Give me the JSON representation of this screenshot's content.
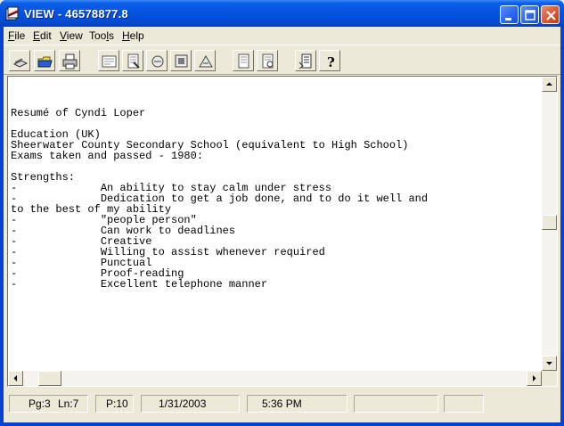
{
  "window": {
    "title": "VIEW - 46578877.8",
    "icons": [
      "app-icon"
    ],
    "controls": [
      "minimize-icon",
      "maximize-icon",
      "close-icon"
    ]
  },
  "menubar": {
    "items": [
      {
        "label": "File",
        "accel": "F",
        "rest": "ile"
      },
      {
        "label": "Edit",
        "accel": "E",
        "rest": "dit"
      },
      {
        "label": "View",
        "accel": "V",
        "rest": "iew"
      },
      {
        "label": "Tools",
        "pre": "Too",
        "accel": "l",
        "rest": "s"
      },
      {
        "label": "Help",
        "accel": "H",
        "rest": "elp"
      }
    ]
  },
  "toolbar": {
    "buttons": [
      "open-icon",
      "folder-icon",
      "print-icon",
      "view-a-icon",
      "view-b-icon",
      "view-c-icon",
      "view-d-icon",
      "view-e-icon",
      "page-prev-icon",
      "page-next-icon",
      "doc-info-icon",
      "help-icon"
    ]
  },
  "document": {
    "lines": [
      "Resumé of Cyndi Loper",
      "",
      "Education (UK)",
      "Sheerwater County Secondary School (equivalent to High School)",
      "Exams taken and passed - 1980:",
      "",
      "Strengths:",
      "-             An ability to stay calm under stress",
      "-             Dedication to get a job done, and to do it well and",
      "to the best of my ability",
      "-             \"people person\"",
      "-             Can work to deadlines",
      "-             Creative",
      "-             Willing to assist whenever required",
      "-             Punctual",
      "-             Proof-reading",
      "-             Excellent telephone manner"
    ]
  },
  "statusbar": {
    "page": "Pg:3",
    "line": "Ln:7",
    "paragraph": "P:10",
    "date": "1/31/2003",
    "time": "5:36 PM",
    "extra1": "",
    "extra2": ""
  },
  "colors": {
    "titlebar": "#0453e0",
    "chrome": "#ece9d8",
    "document_bg": "#ffffff",
    "close_button": "#d8542c"
  }
}
